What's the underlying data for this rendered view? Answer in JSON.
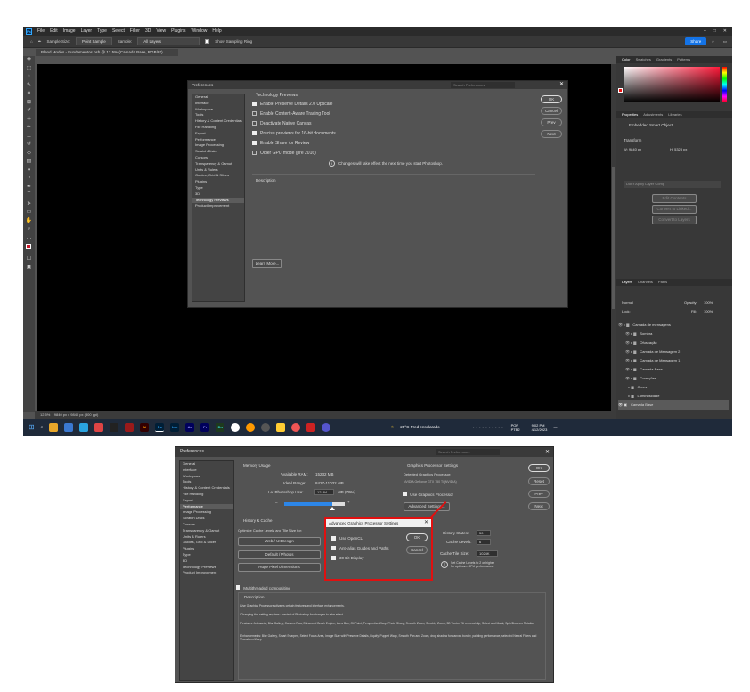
{
  "top": {
    "menubar": {
      "logo": "Ps",
      "items": [
        "File",
        "Edit",
        "Image",
        "Layer",
        "Type",
        "Select",
        "Filter",
        "3D",
        "View",
        "Plugins",
        "Window",
        "Help"
      ],
      "window_controls": [
        "–",
        "□",
        "✕"
      ]
    },
    "optionsbar": {
      "sample_size_label": "Sample Size:",
      "sample_size_value": "Point Sample",
      "sample_label": "Sample:",
      "sample_value": "All Layers",
      "show_ring_label": "Show Sampling Ring",
      "share_label": "Share"
    },
    "doc_tab": "Blend Modes - Fundamentos.psb @ 12.5% (Camada Base, RGB/8*)",
    "toolbar_icons": [
      "move-icon",
      "marquee-icon",
      "lasso-icon",
      "quick-select-icon",
      "crop-icon",
      "frame-icon",
      "eyedropper-icon",
      "healing-icon",
      "brush-icon",
      "stamp-icon",
      "history-brush-icon",
      "eraser-icon",
      "gradient-icon",
      "blur-icon",
      "dodge-icon",
      "pen-icon",
      "type-icon",
      "path-select-icon",
      "shape-icon",
      "hand-icon",
      "zoom-icon",
      "more-icon"
    ],
    "statusbar": {
      "zoom": "12.5%",
      "size": "9840 px x 9840 px (300 ppi)"
    },
    "taskbar": {
      "weather": "25°C  Pred ensolarado",
      "lang": "POR PTB2",
      "time": "9:02 PM",
      "date": "4/12/2023"
    },
    "right_panels": {
      "color_tabs": [
        "Color",
        "Swatches",
        "Gradients",
        "Patterns"
      ],
      "props_tabs": [
        "Properties",
        "Adjustments",
        "Libraries"
      ],
      "props_title": "Embedded Smart Object",
      "transform_label": "Transform",
      "w_label": "W:  9840 px",
      "h_label": "H:  5328 px",
      "layer_comps_label": "Don't Apply Layer Comp",
      "edit_contents": "Edit Contents",
      "convert_linked": "Convert to Linked...",
      "convert_layers": "Convert to Layers",
      "layers_tabs": [
        "Layers",
        "Channels",
        "Paths"
      ],
      "blend_mode": "Normal",
      "opacity_label": "Opacity:",
      "opacity_value": "100%",
      "lock_label": "Lock:",
      "fill_label": "Fill:",
      "fill_value": "100%",
      "layers": [
        "Camada de mensagens",
        "Sombra",
        "Ofuscação",
        "Camada de Mensagem 2",
        "Camada de Mensagem 1",
        "Camada Base",
        "Correções",
        "Cores",
        "Luminosidade",
        "Camada Base"
      ]
    },
    "pref_dialog": {
      "title": "Preferences",
      "search_placeholder": "Search Preferences",
      "sidebar": [
        "General",
        "Interface",
        "Workspace",
        "Tools",
        "History & Content Credentials",
        "File Handling",
        "Export",
        "Performance",
        "Image Processing",
        "Scratch Disks",
        "Cursors",
        "Transparency & Gamut",
        "Units & Rulers",
        "Guides, Grid & Slices",
        "Plugins",
        "Type",
        "3D",
        "Technology Previews",
        "Product Improvement"
      ],
      "active_index": 17,
      "section_title": "Technology Previews",
      "options": [
        {
          "label": "Enable Preserve Details 2.0 Upscale",
          "checked": true
        },
        {
          "label": "Enable Content-Aware Tracing Tool",
          "checked": false
        },
        {
          "label": "Deactivate Native Canvas",
          "checked": false
        },
        {
          "label": "Precise previews for 16-bit documents",
          "checked": true
        },
        {
          "label": "Enable Share for Review",
          "checked": true
        },
        {
          "label": "Older GPU mode (pre 2016)",
          "checked": false
        }
      ],
      "info_text": "Changes will take effect the next time you start Photoshop.",
      "description_label": "Description",
      "learn_more": "Learn More...",
      "buttons": [
        "OK",
        "Cancel",
        "Prev",
        "Next"
      ]
    }
  },
  "bottom": {
    "title": "Preferences",
    "search_placeholder": "Search Preferences",
    "sidebar": [
      "General",
      "Interface",
      "Workspace",
      "Tools",
      "History & Content Credentials",
      "File Handling",
      "Export",
      "Performance",
      "Image Processing",
      "Scratch Disks",
      "Cursors",
      "Transparency & Gamut",
      "Units & Rulers",
      "Guides, Grid & Slices",
      "Plugins",
      "Type",
      "3D",
      "Technology Previews",
      "Product Improvement"
    ],
    "active_index": 7,
    "memory": {
      "title": "Memory Usage",
      "available_label": "Available RAM:",
      "available_value": "15232 MB",
      "ideal_label": "Ideal Range:",
      "ideal_value": "8427-11032 MB",
      "let_label": "Let Photoshop Use:",
      "let_value": "12184",
      "let_unit": "MB (79%)",
      "slider_percent": 79
    },
    "gpu": {
      "title": "Graphics Processor Settings",
      "detected_label": "Detected Graphics Processor:",
      "detected_value": "NVIDIA GeForce GTX 750 Ti (NVIDIA)",
      "use_gpu": "Use Graphics Processor",
      "advanced_button": "Advanced Settings..."
    },
    "history": {
      "title": "History & Cache",
      "optimize_label": "Optimize Cache Levels and Tile Size for:",
      "buttons": [
        "Web / UI Design",
        "Default / Photos",
        "Huge Pixel Dimensions"
      ],
      "history_states_label": "History States:",
      "history_states_value": "50",
      "cache_levels_label": "Cache Levels:",
      "cache_levels_value": "6",
      "tile_size_label": "Cache Tile Size:",
      "tile_size_value": "1024K",
      "tip": "Set Cache Levels to 2 or higher for optimum GPU performance."
    },
    "multithreaded": "Multithreaded compositing",
    "description_title": "Description",
    "description_lines": [
      "Use Graphics Processor activates certain features and interface enhancements.",
      "Changing this setting requires a restart of Photoshop for changes to take effect.",
      "Features: Artboards, Blur Gallery, Camera Raw, Enhanced Brush Engine, Lens Blur, Oil Paint, Perspective Warp, Photo Sharp, Smooth Zoom, Scrubby Zoom, 3D Vector Tilt on brush tip, Select and Mask, Spin/Brushes Rotation",
      "Enhancements: Blur Gallery, Smart Sharpen, Select Focus Area, Image Size with Preserve Details, Liquify, Puppet Warp, Smooth Pan and Zoom, drop shadow for canvas border, painting performance, selected Neural Filters and Transform/Warp"
    ],
    "buttons": [
      "OK",
      "Reset",
      "Prev",
      "Next"
    ],
    "advanced_dialog": {
      "title": "Advanced Graphics Processor Settings",
      "options": [
        {
          "label": "Use OpenCL",
          "checked": true
        },
        {
          "label": "Anti-alias Guides and Paths",
          "checked": true
        },
        {
          "label": "30 Bit Display",
          "checked": true
        }
      ],
      "ok": "OK",
      "cancel": "Cancel"
    }
  }
}
